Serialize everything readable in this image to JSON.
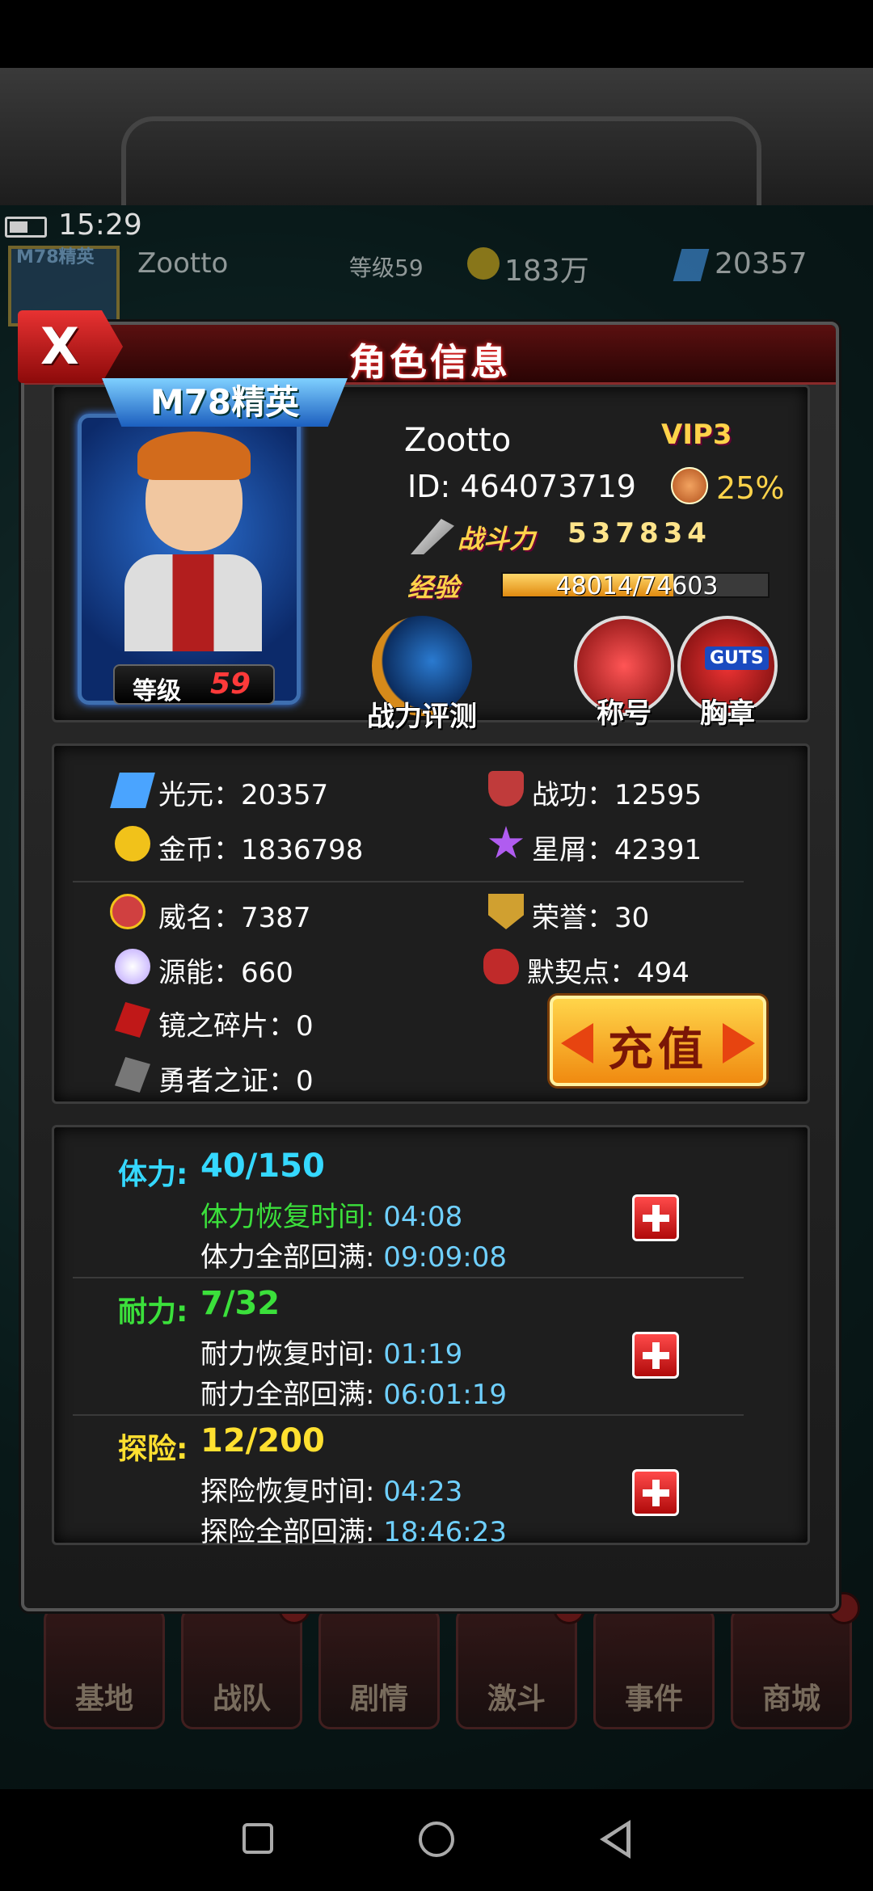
{
  "status_bar": {
    "time": "15:29"
  },
  "game_bar": {
    "rank_badge": "M78精英",
    "player_name": "Zootto",
    "level_label": "等级59",
    "gold": "183万",
    "gems": "20357"
  },
  "dialog": {
    "title": "角色信息",
    "close_label": "X",
    "profile": {
      "rank_badge": "M78精英",
      "level_label": "等级",
      "level_value": "59",
      "name": "Zootto",
      "vip": "VIP3",
      "id_text": "ID: 464073719",
      "medal_percent": "25%",
      "power_label": "战斗力",
      "power_value": "537834",
      "exp_label": "经验",
      "exp_text": "48014/74603",
      "exp_fraction": 0.644,
      "buttons": {
        "eval": "战力评测",
        "title": "称号",
        "badge": "胸章",
        "badge_logo": "GUTS"
      }
    },
    "resources": {
      "guangyuan": "光元：20357",
      "zhangong": "战功：12595",
      "jinbi": "金币：1836798",
      "xingxie": "星屑：42391",
      "weiming": "威名：7387",
      "rongyu": "荣誉：30",
      "yuanneng": "源能：660",
      "moqidian": "默契点：494",
      "jingzhisuipian": "镜之碎片：0",
      "yongzhezhizheng": "勇者之证：0",
      "recharge": "充值"
    },
    "stamina": [
      {
        "label": "体力:",
        "value": "40/150",
        "label_color": "#35d8ff",
        "recover_label": "体力恢复时间:",
        "recover_time": "04:08",
        "full_label": "体力全部回满:",
        "full_time": "09:09:08"
      },
      {
        "label": "耐力:",
        "value": "7/32",
        "label_color": "#3be03b",
        "recover_label": "耐力恢复时间:",
        "recover_time": "01:19",
        "full_label": "耐力全部回满:",
        "full_time": "06:01:19"
      },
      {
        "label": "探险:",
        "value": "12/200",
        "label_color": "#ffe030",
        "recover_label": "探险恢复时间:",
        "recover_time": "04:23",
        "full_label": "探险全部回满:",
        "full_time": "18:46:23"
      }
    ]
  },
  "bottom_nav": [
    {
      "label": "基地"
    },
    {
      "label": "战队"
    },
    {
      "label": "剧情"
    },
    {
      "label": "激斗"
    },
    {
      "label": "事件"
    },
    {
      "label": "商城"
    }
  ]
}
